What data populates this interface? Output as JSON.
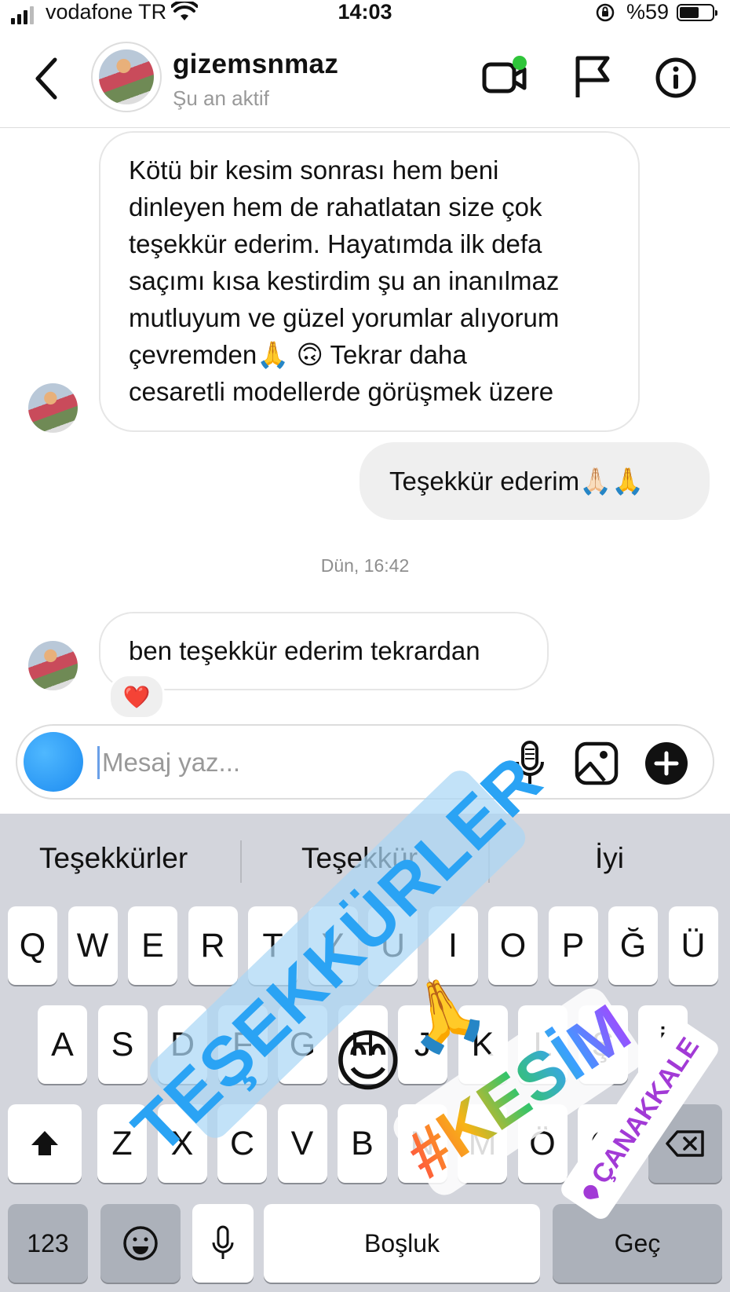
{
  "status": {
    "carrier": "vodafone TR",
    "time": "14:03",
    "battery": "%59",
    "battery_level": 0.59
  },
  "header": {
    "username": "gizemsnmaz",
    "status": "Şu an aktif"
  },
  "messages": {
    "received_1": [
      "Kötü bir kesim sonrası hem beni",
      "dinleyen hem de rahatlatan size çok",
      "teşekkür ederim. Hayatımda ilk defa",
      "saçımı kısa kestirdim şu an inanılmaz",
      "mutluyum ve güzel yorumlar alıyorum",
      "çevremden🙏 🙃 Tekrar daha",
      "cesaretli modellerde görüşmek üzere"
    ],
    "sent_1": "Teşekkür ederim🙏🏻🙏",
    "timestamp": "Dün, 16:42",
    "received_2": "ben teşekkür ederim tekrardan",
    "reaction": "❤️"
  },
  "composer": {
    "placeholder": "Mesaj yaz..."
  },
  "keyboard": {
    "suggestions": [
      "Teşekkürler",
      "Teşekkür",
      "İyi"
    ],
    "row1": [
      "Q",
      "W",
      "E",
      "R",
      "T",
      "Y",
      "U",
      "I",
      "O",
      "P",
      "Ğ",
      "Ü"
    ],
    "row2": [
      "A",
      "S",
      "D",
      "F",
      "G",
      "H",
      "J",
      "K",
      "L",
      "Ş",
      "İ"
    ],
    "row3": [
      "Z",
      "X",
      "C",
      "V",
      "B",
      "N",
      "M",
      "Ö",
      "Ç"
    ],
    "numbers": "123",
    "space": "Boşluk",
    "go": "Geç"
  },
  "stickers": {
    "thanks": "TEŞEKKÜRLER",
    "hashtag": "#KESİM",
    "location": "ÇANAKKALE",
    "smile": "😊",
    "hands": "🙏"
  }
}
